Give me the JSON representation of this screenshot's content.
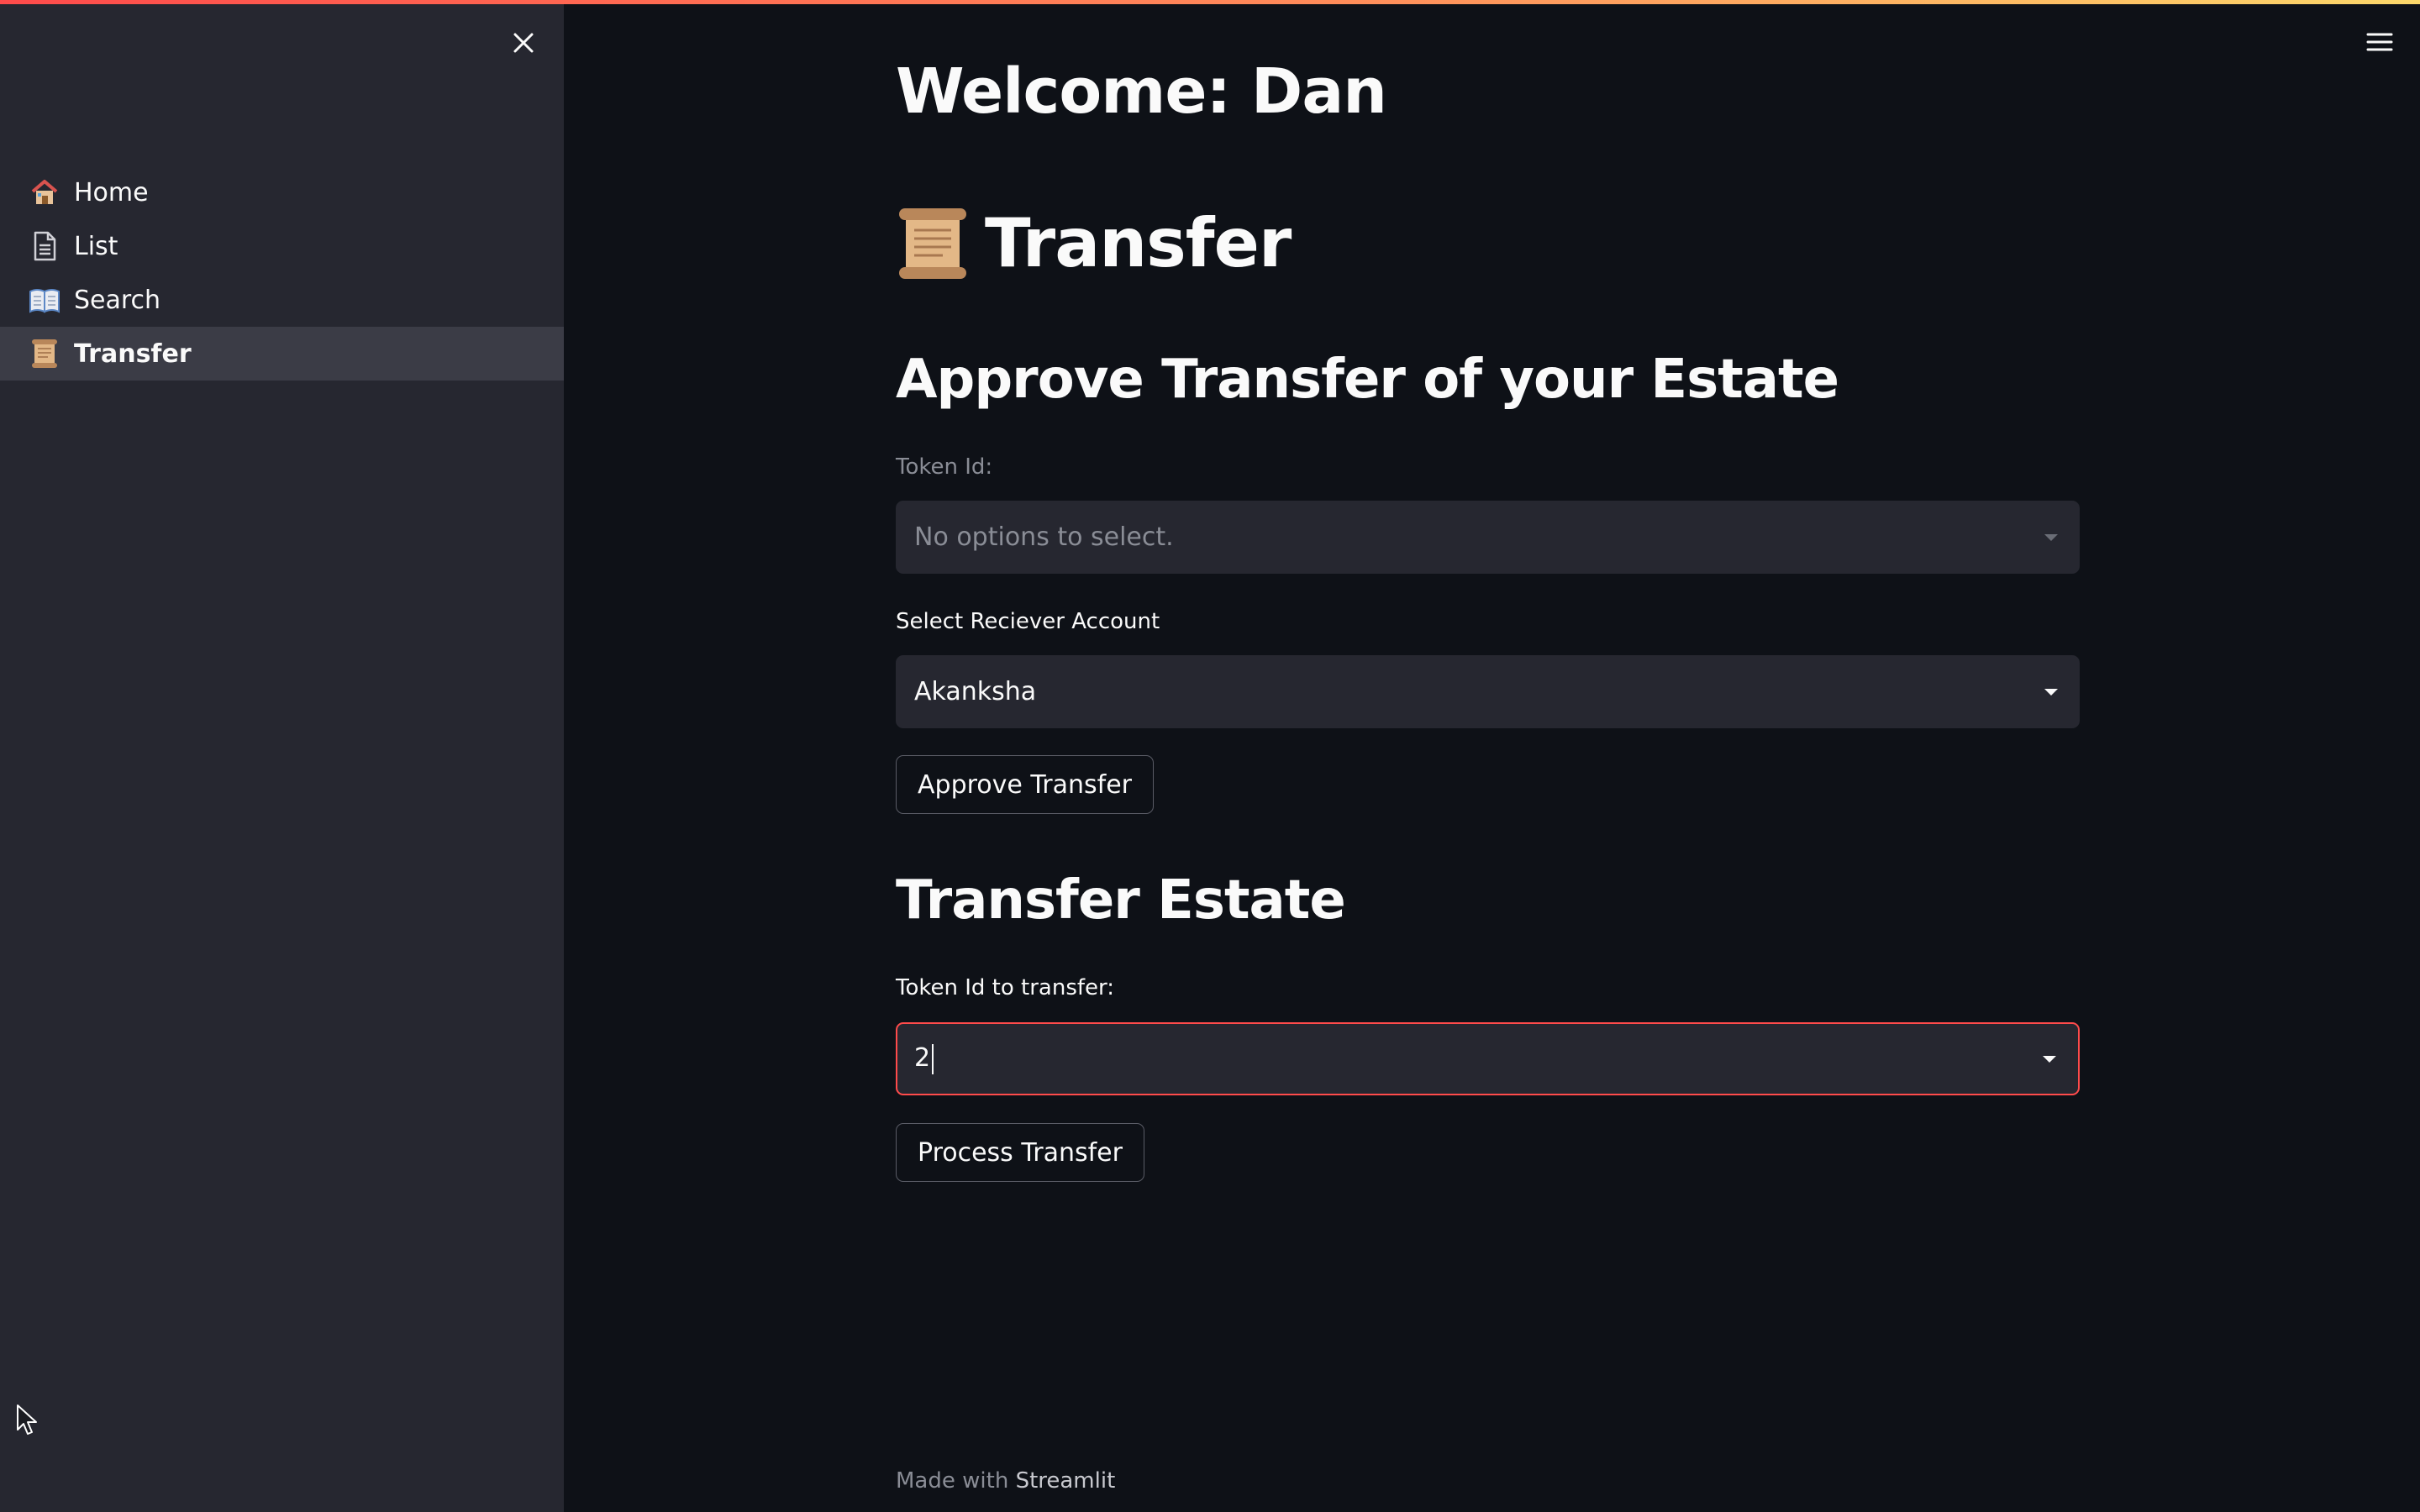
{
  "sidebar": {
    "items": [
      {
        "label": "Home",
        "icon": "house-icon"
      },
      {
        "label": "List",
        "icon": "document-icon"
      },
      {
        "label": "Search",
        "icon": "open-book-icon"
      },
      {
        "label": "Transfer",
        "icon": "scroll-icon",
        "active": true
      }
    ]
  },
  "main": {
    "welcome": "Welcome: Dan",
    "page_title": "Transfer",
    "approve_section": {
      "heading": "Approve Transfer of your Estate",
      "token_label": "Token Id:",
      "token_placeholder": "No options to select.",
      "receiver_label": "Select Reciever Account",
      "receiver_value": "Akanksha",
      "button": "Approve Transfer"
    },
    "transfer_section": {
      "heading": "Transfer Estate",
      "token_label": "Token Id to transfer:",
      "token_value": "2",
      "button": "Process Transfer"
    },
    "footer": {
      "prefix": "Made with",
      "brand": "Streamlit"
    }
  },
  "colors": {
    "background": "#0e1117",
    "sidebar": "#262730",
    "accent": "#ff4b4b",
    "input": "#262730"
  }
}
